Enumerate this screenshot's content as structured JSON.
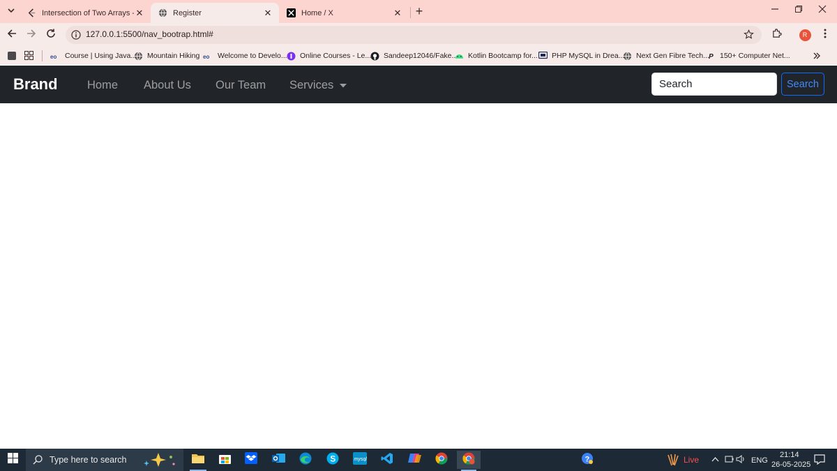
{
  "browser": {
    "tabs": [
      {
        "title": "Intersection of Two Arrays - Lee",
        "icon": "leetcode-icon"
      },
      {
        "title": "Register",
        "icon": "globe-icon",
        "active": true
      },
      {
        "title": "Home / X",
        "icon": "x-logo-icon"
      }
    ],
    "new_tab": "+",
    "url": "127.0.0.1:5500/nav_bootrap.html#",
    "profile_initial": "R",
    "bookmarks": [
      {
        "label": "Course | Using Java...",
        "icon": "coursera-icon"
      },
      {
        "label": "Mountain Hiking",
        "icon": "globe-icon"
      },
      {
        "label": "Welcome to Develo...",
        "icon": "coursera-icon"
      },
      {
        "label": "Online Courses - Le...",
        "icon": "purple-circle-icon"
      },
      {
        "label": "Sandeep12046/Fake...",
        "icon": "github-icon"
      },
      {
        "label": "Kotlin Bootcamp for...",
        "icon": "android-icon"
      },
      {
        "label": "PHP MySQL in Drea...",
        "icon": "screen-icon"
      },
      {
        "label": "Next Gen Fibre Tech...",
        "icon": "globe-icon"
      },
      {
        "label": "150+ Computer Net...",
        "icon": "p-icon"
      }
    ]
  },
  "navbar": {
    "brand": "Brand",
    "links": [
      "Home",
      "About Us",
      "Our Team",
      "Services"
    ],
    "search_placeholder": "Search",
    "search_button": "Search"
  },
  "taskbar": {
    "search_placeholder": "Type here to search",
    "live_label": "Live",
    "language": "ENG",
    "time": "21:14",
    "date": "26-05-2025"
  },
  "colors": {
    "tab_strip": "#fcd4d0",
    "toolbar": "#f7ebea",
    "navbar": "#212529",
    "primary": "#0d6efd",
    "taskbar": "#1d2a36"
  }
}
